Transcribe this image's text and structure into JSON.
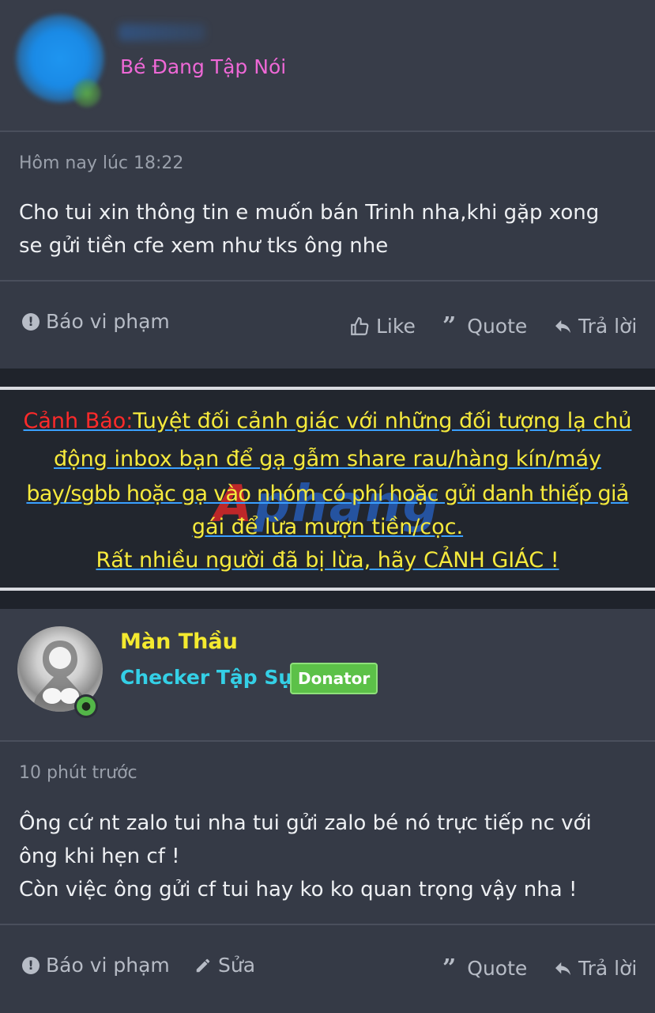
{
  "post1": {
    "username": "",
    "user_title": "Bé Đang Tập Nói",
    "time": "Hôm nay lúc 18:22",
    "body_lines": [
      "Cho tui xin thông tin e muốn bán Trinh nha,khi gặp xong",
      "se gửi tiền cfe xem như tks ông nhe"
    ],
    "actions": {
      "report": "Báo vi phạm",
      "like": "Like",
      "quote": "Quote",
      "reply": "Trả lời"
    }
  },
  "warning": {
    "label": "Cảnh Báo:",
    "lines": [
      "Tuyệt đối cảnh giác với những đối tượng lạ chủ",
      "động inbox bạn để gạ gẫm share rau/hàng kín/máy",
      "bay/sgbb hoặc gạ vào nhóm có phí hoặc gửi danh thiếp giả",
      "gái để lừa mượn tiền/cọc.",
      "Rất nhiều người đã bị lừa, hãy CẢNH GIÁC !"
    ],
    "watermark_a": "A",
    "watermark_rest": "phang"
  },
  "post2": {
    "username": "Màn Thầu",
    "user_title": "Checker Tập Sự",
    "badge": "Donator",
    "time": "10 phút trước",
    "body_lines": [
      "Ông cứ nt zalo tui nha tui gửi zalo bé nó trực tiếp nc với",
      "ông khi hẹn cf !",
      "Còn việc ông gửi cf tui hay ko ko quan trọng vậy nha !"
    ],
    "actions": {
      "report": "Báo vi phạm",
      "edit": "Sửa",
      "quote": "Quote",
      "reply": "Trả lời"
    }
  },
  "colors": {
    "pink_title": "#ee68d6",
    "warning_text": "#f6ea3c",
    "warning_label": "#ff2a2a",
    "username_yellow": "#f4ea2f",
    "title_cyan": "#34d0e6",
    "badge_green": "#5cc148"
  }
}
